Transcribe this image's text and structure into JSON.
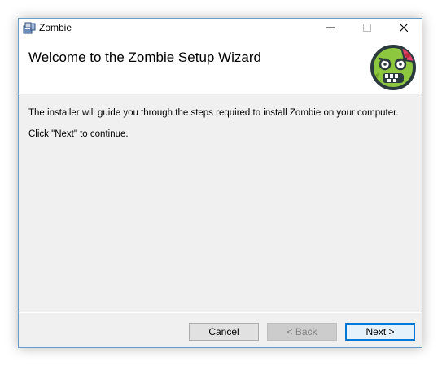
{
  "window": {
    "title": "Zombie"
  },
  "titlebar": {
    "controls": [
      "minimize-icon",
      "maximize-icon",
      "close-icon"
    ]
  },
  "header": {
    "title": "Welcome to the Zombie Setup Wizard",
    "logo_icon": "zombie-face-icon"
  },
  "body": {
    "lines": [
      "The installer will guide you through the steps required to install Zombie on your computer.",
      "Click \"Next\" to continue."
    ]
  },
  "buttons": {
    "cancel": "Cancel",
    "back": "< Back",
    "next": "Next >"
  },
  "colors": {
    "zombie_green": "#8dc63f",
    "zombie_outline": "#2b3a3d",
    "accent_pink": "#e0416a",
    "focus_blue": "#0078d7"
  }
}
